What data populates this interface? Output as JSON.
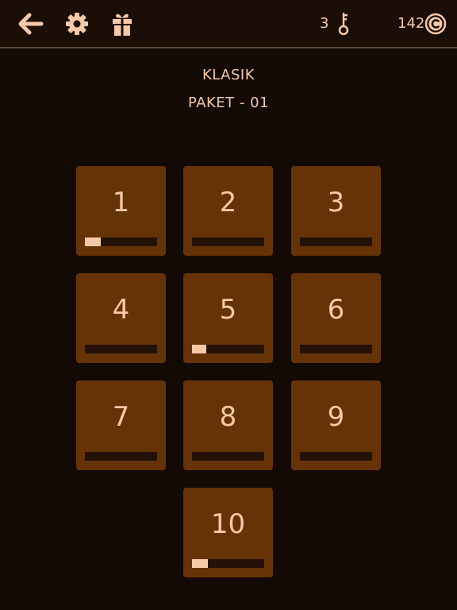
{
  "header": {
    "keys_count": "3",
    "coins_count": "142",
    "icons": [
      "back-arrow-icon",
      "gear-icon",
      "gift-icon",
      "key-icon",
      "coin-icon"
    ]
  },
  "pack": {
    "category": "KLASIK",
    "name": "PAKET - 01"
  },
  "colors": {
    "background": "#130905",
    "tile": "#663307",
    "accent": "#f6c9a8",
    "bar_track": "#241209"
  },
  "levels": [
    {
      "label": "1",
      "progress": 0.22
    },
    {
      "label": "2",
      "progress": 0
    },
    {
      "label": "3",
      "progress": 0
    },
    {
      "label": "4",
      "progress": 0
    },
    {
      "label": "5",
      "progress": 0.2
    },
    {
      "label": "6",
      "progress": 0
    },
    {
      "label": "7",
      "progress": 0
    },
    {
      "label": "8",
      "progress": 0
    },
    {
      "label": "9",
      "progress": 0
    },
    {
      "label": "10",
      "progress": 0.22
    }
  ]
}
